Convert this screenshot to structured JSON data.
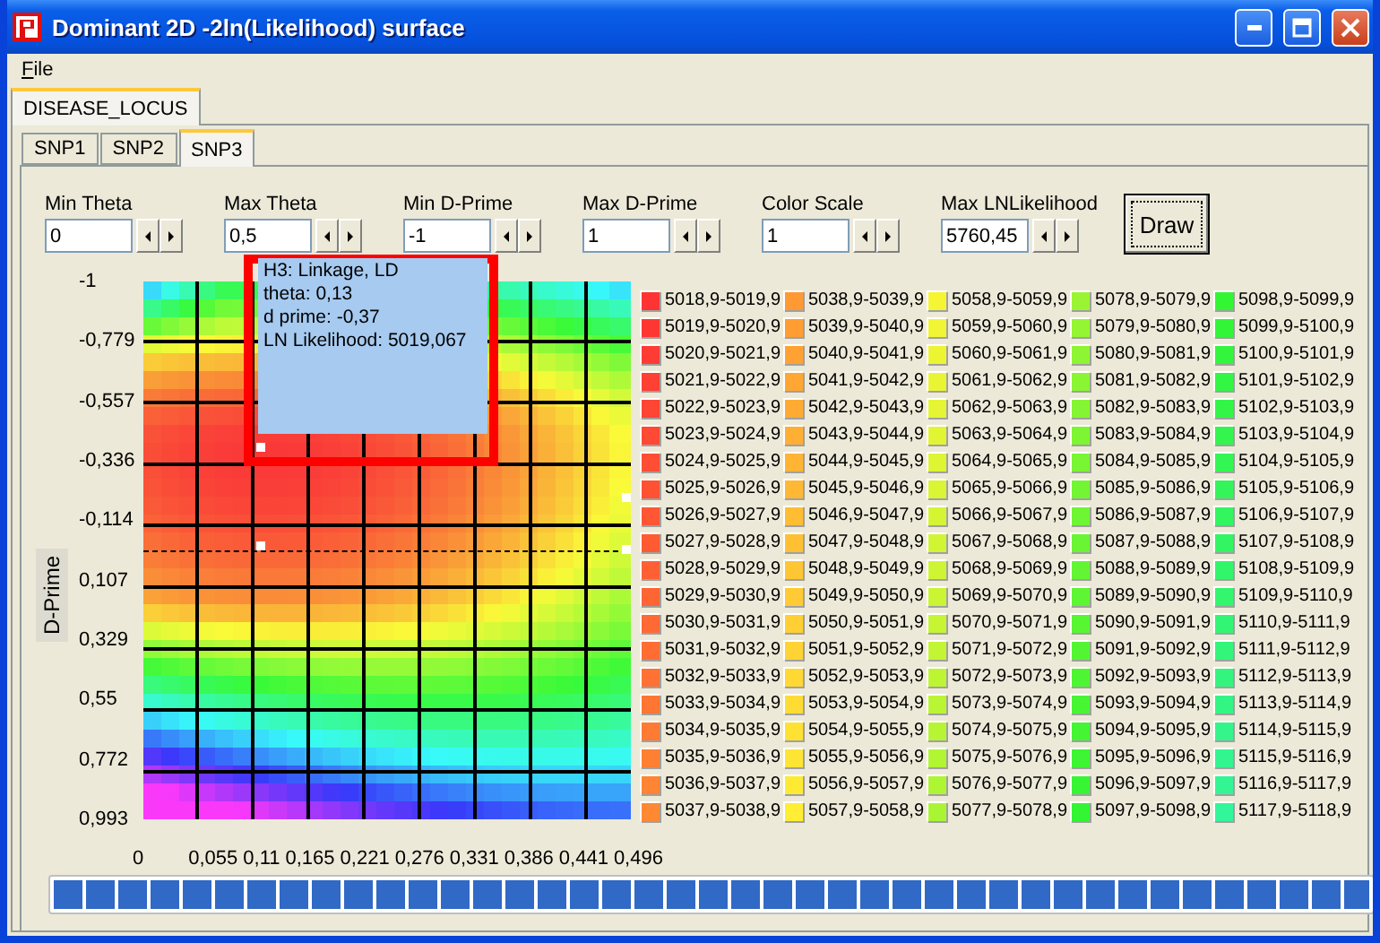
{
  "window": {
    "title": "Dominant 2D -2ln(Likelihood) surface"
  },
  "menu": [
    {
      "label": "File"
    }
  ],
  "outer_tabs": [
    {
      "label": "DISEASE_LOCUS",
      "selected": true
    }
  ],
  "tabs": [
    {
      "label": "SNP1",
      "selected": false
    },
    {
      "label": "SNP2",
      "selected": false
    },
    {
      "label": "SNP3",
      "selected": true
    }
  ],
  "fields": [
    {
      "label": "Min Theta",
      "value": "0"
    },
    {
      "label": "Max Theta",
      "value": "0,5"
    },
    {
      "label": "Min D-Prime",
      "value": "-1"
    },
    {
      "label": "Max D-Prime",
      "value": "1"
    },
    {
      "label": "Color Scale",
      "value": "1"
    },
    {
      "label": "Max LNLikelihood",
      "value": "5760,45"
    }
  ],
  "draw_button": {
    "label": "Draw",
    "focused": true
  },
  "chart": {
    "y_title": "D-Prime",
    "y_ticks": [
      "-1",
      "-0,779",
      "-0,557",
      "-0,336",
      "-0,114",
      "0,107",
      "0,329",
      "0,55",
      "0,772",
      "0,993"
    ],
    "x_ticks": [
      "0",
      "0,055",
      "0,11",
      "0,165",
      "0,221",
      "0,276",
      "0,331",
      "0,386",
      "0,441",
      "0,496"
    ],
    "tooltip": [
      "H3: Linkage, LD",
      "theta: 0,13",
      "d prime: -0,37",
      "LN Likelihood: 5019,067"
    ]
  },
  "legend": [
    {
      "label": "5018,9-5019,9",
      "color": "#ff3333"
    },
    {
      "label": "5019,9-5020,9",
      "color": "#ff3733"
    },
    {
      "label": "5020,9-5021,9",
      "color": "#ff3c33"
    },
    {
      "label": "5021,9-5022,9",
      "color": "#ff4033"
    },
    {
      "label": "5022,9-5023,9",
      "color": "#ff4533"
    },
    {
      "label": "5023,9-5024,9",
      "color": "#ff4933"
    },
    {
      "label": "5024,9-5025,9",
      "color": "#ff4e33"
    },
    {
      "label": "5025,9-5026,9",
      "color": "#ff5233"
    },
    {
      "label": "5026,9-5027,9",
      "color": "#ff5733"
    },
    {
      "label": "5027,9-5028,9",
      "color": "#ff5b33"
    },
    {
      "label": "5028,9-5029,9",
      "color": "#ff6033"
    },
    {
      "label": "5029,9-5030,9",
      "color": "#ff6433"
    },
    {
      "label": "5030,9-5031,9",
      "color": "#ff6933"
    },
    {
      "label": "5031,9-5032,9",
      "color": "#ff6d33"
    },
    {
      "label": "5032,9-5033,9",
      "color": "#ff7233"
    },
    {
      "label": "5033,9-5034,9",
      "color": "#ff7633"
    },
    {
      "label": "5034,9-5035,9",
      "color": "#ff7b33"
    },
    {
      "label": "5035,9-5036,9",
      "color": "#ff7f33"
    },
    {
      "label": "5036,9-5037,9",
      "color": "#ff8433"
    },
    {
      "label": "5037,9-5038,9",
      "color": "#ff8833"
    },
    {
      "label": "5038,9-5039,9",
      "color": "#ff9933"
    },
    {
      "label": "5039,9-5040,9",
      "color": "#ff9d33"
    },
    {
      "label": "5040,9-5041,9",
      "color": "#ffa233"
    },
    {
      "label": "5041,9-5042,9",
      "color": "#ffa633"
    },
    {
      "label": "5042,9-5043,9",
      "color": "#ffab33"
    },
    {
      "label": "5043,9-5044,9",
      "color": "#ffaf33"
    },
    {
      "label": "5044,9-5045,9",
      "color": "#ffb433"
    },
    {
      "label": "5045,9-5046,9",
      "color": "#ffb833"
    },
    {
      "label": "5046,9-5047,9",
      "color": "#ffbd33"
    },
    {
      "label": "5047,9-5048,9",
      "color": "#ffc133"
    },
    {
      "label": "5048,9-5049,9",
      "color": "#ffc633"
    },
    {
      "label": "5049,9-5050,9",
      "color": "#ffca33"
    },
    {
      "label": "5050,9-5051,9",
      "color": "#ffcf33"
    },
    {
      "label": "5051,9-5052,9",
      "color": "#ffd333"
    },
    {
      "label": "5052,9-5053,9",
      "color": "#ffd833"
    },
    {
      "label": "5053,9-5054,9",
      "color": "#ffdc33"
    },
    {
      "label": "5054,9-5055,9",
      "color": "#ffe133"
    },
    {
      "label": "5055,9-5056,9",
      "color": "#ffe533"
    },
    {
      "label": "5056,9-5057,9",
      "color": "#ffea33"
    },
    {
      "label": "5057,9-5058,9",
      "color": "#ffee33"
    },
    {
      "label": "5058,9-5059,9",
      "color": "#f5f533"
    },
    {
      "label": "5059,9-5060,9",
      "color": "#f1f533"
    },
    {
      "label": "5060,9-5061,9",
      "color": "#edf533"
    },
    {
      "label": "5061,9-5062,9",
      "color": "#e9f533"
    },
    {
      "label": "5062,9-5063,9",
      "color": "#e5f533"
    },
    {
      "label": "5063,9-5064,9",
      "color": "#e1f533"
    },
    {
      "label": "5064,9-5065,9",
      "color": "#ddf533"
    },
    {
      "label": "5065,9-5066,9",
      "color": "#d9f533"
    },
    {
      "label": "5066,9-5067,9",
      "color": "#d5f533"
    },
    {
      "label": "5067,9-5068,9",
      "color": "#d1f533"
    },
    {
      "label": "5068,9-5069,9",
      "color": "#cef533"
    },
    {
      "label": "5069,9-5070,9",
      "color": "#caf533"
    },
    {
      "label": "5070,9-5071,9",
      "color": "#c6f533"
    },
    {
      "label": "5071,9-5072,9",
      "color": "#c2f533"
    },
    {
      "label": "5072,9-5073,9",
      "color": "#bef533"
    },
    {
      "label": "5073,9-5074,9",
      "color": "#baf533"
    },
    {
      "label": "5074,9-5075,9",
      "color": "#b6f533"
    },
    {
      "label": "5075,9-5076,9",
      "color": "#b2f533"
    },
    {
      "label": "5076,9-5077,9",
      "color": "#aef533"
    },
    {
      "label": "5077,9-5078,9",
      "color": "#aaf533"
    },
    {
      "label": "5078,9-5079,9",
      "color": "#99f533"
    },
    {
      "label": "5079,9-5080,9",
      "color": "#94f533"
    },
    {
      "label": "5080,9-5081,9",
      "color": "#8ef533"
    },
    {
      "label": "5081,9-5082,9",
      "color": "#89f533"
    },
    {
      "label": "5082,9-5083,9",
      "color": "#84f533"
    },
    {
      "label": "5083,9-5084,9",
      "color": "#7ef533"
    },
    {
      "label": "5084,9-5085,9",
      "color": "#79f533"
    },
    {
      "label": "5085,9-5086,9",
      "color": "#73f533"
    },
    {
      "label": "5086,9-5087,9",
      "color": "#6ef533"
    },
    {
      "label": "5087,9-5088,9",
      "color": "#69f533"
    },
    {
      "label": "5088,9-5089,9",
      "color": "#63f533"
    },
    {
      "label": "5089,9-5090,9",
      "color": "#5ef533"
    },
    {
      "label": "5090,9-5091,9",
      "color": "#58f533"
    },
    {
      "label": "5091,9-5092,9",
      "color": "#53f533"
    },
    {
      "label": "5092,9-5093,9",
      "color": "#4ef533"
    },
    {
      "label": "5093,9-5094,9",
      "color": "#48f533"
    },
    {
      "label": "5094,9-5095,9",
      "color": "#43f533"
    },
    {
      "label": "5095,9-5096,9",
      "color": "#3df533"
    },
    {
      "label": "5096,9-5097,9",
      "color": "#38f533"
    },
    {
      "label": "5097,9-5098,9",
      "color": "#33f533"
    },
    {
      "label": "5098,9-5099,9",
      "color": "#33f533"
    },
    {
      "label": "5099,9-5100,9",
      "color": "#33f538"
    },
    {
      "label": "5100,9-5101,9",
      "color": "#33f53e"
    },
    {
      "label": "5101,9-5102,9",
      "color": "#33f543"
    },
    {
      "label": "5102,9-5103,9",
      "color": "#33f548"
    },
    {
      "label": "5103,9-5104,9",
      "color": "#33f54e"
    },
    {
      "label": "5104,9-5105,9",
      "color": "#33f553"
    },
    {
      "label": "5105,9-5106,9",
      "color": "#33f559"
    },
    {
      "label": "5106,9-5107,9",
      "color": "#33f55e"
    },
    {
      "label": "5107,9-5108,9",
      "color": "#33f563"
    },
    {
      "label": "5108,9-5109,9",
      "color": "#33f569"
    },
    {
      "label": "5109,9-5110,9",
      "color": "#33f56e"
    },
    {
      "label": "5110,9-5111,9",
      "color": "#33f574"
    },
    {
      "label": "5111,9-5112,9",
      "color": "#33f579"
    },
    {
      "label": "5112,9-5113,9",
      "color": "#33f57e"
    },
    {
      "label": "5113,9-5114,9",
      "color": "#33f584"
    },
    {
      "label": "5114,9-5115,9",
      "color": "#33f589"
    },
    {
      "label": "5115,9-5116,9",
      "color": "#33f58f"
    },
    {
      "label": "5116,9-5117,9",
      "color": "#33f594"
    },
    {
      "label": "5117,9-5118,9",
      "color": "#33f599"
    }
  ],
  "progress": {
    "level": 1
  }
}
